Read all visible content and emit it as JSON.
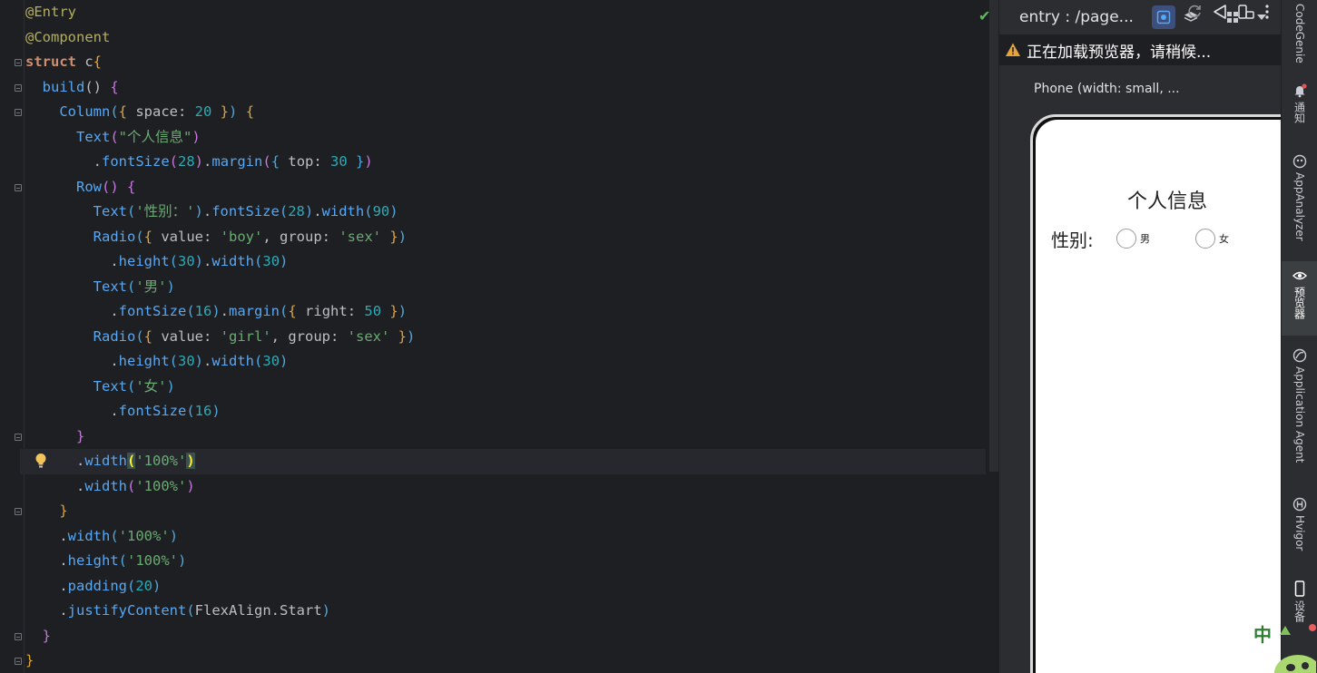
{
  "editor": {
    "lines": [
      [
        [
          "an",
          "@Entry"
        ]
      ],
      [
        [
          "an",
          "@Component"
        ]
      ],
      [
        [
          "kw",
          "struct "
        ],
        [
          "ty2",
          "c"
        ],
        [
          "br1",
          "{"
        ]
      ],
      [
        [
          "",
          "  "
        ],
        [
          "fn",
          "build"
        ],
        [
          "paren",
          "() "
        ],
        [
          "br2",
          "{"
        ]
      ],
      [
        [
          "",
          "    "
        ],
        [
          "fn",
          "Column"
        ],
        [
          "br3",
          "("
        ],
        [
          "br1",
          "{ "
        ],
        [
          "",
          "space: "
        ],
        [
          "nu",
          "20"
        ],
        [
          "br1",
          " }"
        ],
        [
          "br3",
          ")"
        ],
        [
          "br1",
          " {"
        ]
      ],
      [
        [
          "",
          "      "
        ],
        [
          "fn",
          "Text"
        ],
        [
          "br2",
          "("
        ],
        [
          "st",
          "\"个人信息\""
        ],
        [
          "br2",
          ")"
        ]
      ],
      [
        [
          "",
          "        ."
        ],
        [
          "fn",
          "fontSize"
        ],
        [
          "br2",
          "("
        ],
        [
          "nu",
          "28"
        ],
        [
          "br2",
          ")"
        ],
        [
          "",
          "."
        ],
        [
          "fn",
          "margin"
        ],
        [
          "br2",
          "("
        ],
        [
          "br3",
          "{ "
        ],
        [
          "",
          "top: "
        ],
        [
          "nu",
          "30"
        ],
        [
          "br3",
          " }"
        ],
        [
          "br2",
          ")"
        ]
      ],
      [
        [
          "",
          "      "
        ],
        [
          "fn",
          "Row"
        ],
        [
          "br2",
          "() {"
        ]
      ],
      [
        [
          "",
          "        "
        ],
        [
          "fn",
          "Text"
        ],
        [
          "br3",
          "("
        ],
        [
          "st",
          "'性别：'"
        ],
        [
          "br3",
          ")"
        ],
        [
          "",
          "."
        ],
        [
          "fn",
          "fontSize"
        ],
        [
          "br3",
          "("
        ],
        [
          "nu",
          "28"
        ],
        [
          "br3",
          ")"
        ],
        [
          "",
          "."
        ],
        [
          "fn",
          "width"
        ],
        [
          "br3",
          "("
        ],
        [
          "nu",
          "90"
        ],
        [
          "br3",
          ")"
        ]
      ],
      [
        [
          "",
          "        "
        ],
        [
          "fn",
          "Radio"
        ],
        [
          "br3",
          "("
        ],
        [
          "br1",
          "{ "
        ],
        [
          "",
          "value: "
        ],
        [
          "st",
          "'boy'"
        ],
        [
          "",
          ", group: "
        ],
        [
          "st",
          "'sex'"
        ],
        [
          "br1",
          " }"
        ],
        [
          "br3",
          ")"
        ]
      ],
      [
        [
          "",
          "          ."
        ],
        [
          "fn",
          "height"
        ],
        [
          "br3",
          "("
        ],
        [
          "nu",
          "30"
        ],
        [
          "br3",
          ")"
        ],
        [
          "",
          "."
        ],
        [
          "fn",
          "width"
        ],
        [
          "br3",
          "("
        ],
        [
          "nu",
          "30"
        ],
        [
          "br3",
          ")"
        ]
      ],
      [
        [
          "",
          "        "
        ],
        [
          "fn",
          "Text"
        ],
        [
          "br3",
          "("
        ],
        [
          "st",
          "'男'"
        ],
        [
          "br3",
          ")"
        ]
      ],
      [
        [
          "",
          "          ."
        ],
        [
          "fn",
          "fontSize"
        ],
        [
          "br3",
          "("
        ],
        [
          "nu",
          "16"
        ],
        [
          "br3",
          ")"
        ],
        [
          "",
          "."
        ],
        [
          "fn",
          "margin"
        ],
        [
          "br3",
          "("
        ],
        [
          "br1",
          "{ "
        ],
        [
          "",
          "right: "
        ],
        [
          "nu",
          "50"
        ],
        [
          "br1",
          " }"
        ],
        [
          "br3",
          ")"
        ]
      ],
      [
        [
          "",
          "        "
        ],
        [
          "fn",
          "Radio"
        ],
        [
          "br3",
          "("
        ],
        [
          "br1",
          "{ "
        ],
        [
          "",
          "value: "
        ],
        [
          "st",
          "'girl'"
        ],
        [
          "",
          ", group: "
        ],
        [
          "st",
          "'sex'"
        ],
        [
          "br1",
          " }"
        ],
        [
          "br3",
          ")"
        ]
      ],
      [
        [
          "",
          "          ."
        ],
        [
          "fn",
          "height"
        ],
        [
          "br3",
          "("
        ],
        [
          "nu",
          "30"
        ],
        [
          "br3",
          ")"
        ],
        [
          "",
          "."
        ],
        [
          "fn",
          "width"
        ],
        [
          "br3",
          "("
        ],
        [
          "nu",
          "30"
        ],
        [
          "br3",
          ")"
        ]
      ],
      [
        [
          "",
          "        "
        ],
        [
          "fn",
          "Text"
        ],
        [
          "br3",
          "("
        ],
        [
          "st",
          "'女'"
        ],
        [
          "br3",
          ")"
        ]
      ],
      [
        [
          "",
          "          ."
        ],
        [
          "fn",
          "fontSize"
        ],
        [
          "br3",
          "("
        ],
        [
          "nu",
          "16"
        ],
        [
          "br3",
          ")"
        ]
      ],
      [
        [
          "",
          "      "
        ],
        [
          "br2",
          "}"
        ]
      ],
      [
        [
          "",
          "      ."
        ],
        [
          "fn",
          "width"
        ],
        [
          "match",
          "("
        ],
        [
          "st",
          "'100%'"
        ],
        [
          "match",
          ")"
        ]
      ],
      [
        [
          "",
          "      ."
        ],
        [
          "fn",
          "width"
        ],
        [
          "br2",
          "("
        ],
        [
          "st",
          "'100%'"
        ],
        [
          "br2",
          ")"
        ]
      ],
      [
        [
          "",
          "    "
        ],
        [
          "br1",
          "}"
        ]
      ],
      [
        [
          "",
          "    ."
        ],
        [
          "fn",
          "width"
        ],
        [
          "br3",
          "("
        ],
        [
          "st",
          "'100%'"
        ],
        [
          "br3",
          ")"
        ]
      ],
      [
        [
          "",
          "    ."
        ],
        [
          "fn",
          "height"
        ],
        [
          "br3",
          "("
        ],
        [
          "st",
          "'100%'"
        ],
        [
          "br3",
          ")"
        ]
      ],
      [
        [
          "",
          "    ."
        ],
        [
          "fn",
          "padding"
        ],
        [
          "br3",
          "("
        ],
        [
          "nu",
          "20"
        ],
        [
          "br3",
          ")"
        ]
      ],
      [
        [
          "",
          "    ."
        ],
        [
          "fn",
          "justifyContent"
        ],
        [
          "br3",
          "("
        ],
        [
          "",
          "FlexAlign.Start"
        ],
        [
          "br3",
          ")"
        ]
      ],
      [
        [
          "",
          "  "
        ],
        [
          "br2",
          "}"
        ]
      ],
      [
        [
          "br1",
          "}"
        ]
      ]
    ],
    "current_line": 18
  },
  "preview": {
    "title": "entry : /page...",
    "loading_text": "正在加载预览器，请稍候...",
    "device_label": "Phone (width: small, ...",
    "app": {
      "title": "个人信息",
      "gender_label": "性别:",
      "option_male": "男",
      "option_female": "女"
    }
  },
  "toolstrip": {
    "tabs": [
      {
        "name": "codegenie",
        "label": "CodeGenie"
      },
      {
        "name": "notifications",
        "label": "通知"
      },
      {
        "name": "appanalyzer",
        "label": "AppAnalyzer"
      },
      {
        "name": "previewer",
        "label": "预览器"
      },
      {
        "name": "application-agent",
        "label": "Application Agent"
      },
      {
        "name": "hvigor",
        "label": "Hvigor"
      },
      {
        "name": "device",
        "label": "设备"
      }
    ]
  },
  "ime": {
    "label": "中"
  }
}
